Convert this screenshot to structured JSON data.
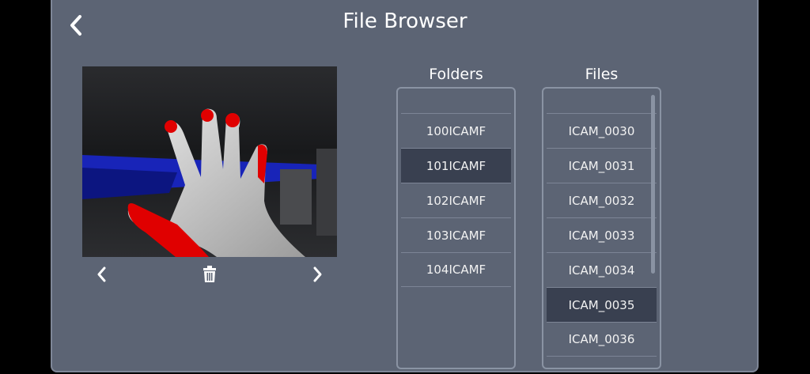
{
  "header": {
    "title": "File Browser",
    "back_icon": "chevron-left-icon"
  },
  "preview": {
    "image_desc_icon": "thermal-image",
    "prev_icon": "chevron-left-icon",
    "delete_icon": "trash-icon",
    "next_icon": "chevron-right-icon"
  },
  "folders": {
    "title": "Folders",
    "items": [
      "100ICAMF",
      "101ICAMF",
      "102ICAMF",
      "103ICAMF",
      "104ICAMF"
    ],
    "selected": "101ICAMF"
  },
  "files": {
    "title": "Files",
    "items": [
      "ICAM_0030",
      "ICAM_0031",
      "ICAM_0032",
      "ICAM_0033",
      "ICAM_0034",
      "ICAM_0035",
      "ICAM_0036"
    ],
    "selected": "ICAM_0035"
  },
  "colors": {
    "panel": "#5c6474",
    "selected_row": "#394050",
    "hot": "#e00000",
    "cold": "#1020b0"
  }
}
